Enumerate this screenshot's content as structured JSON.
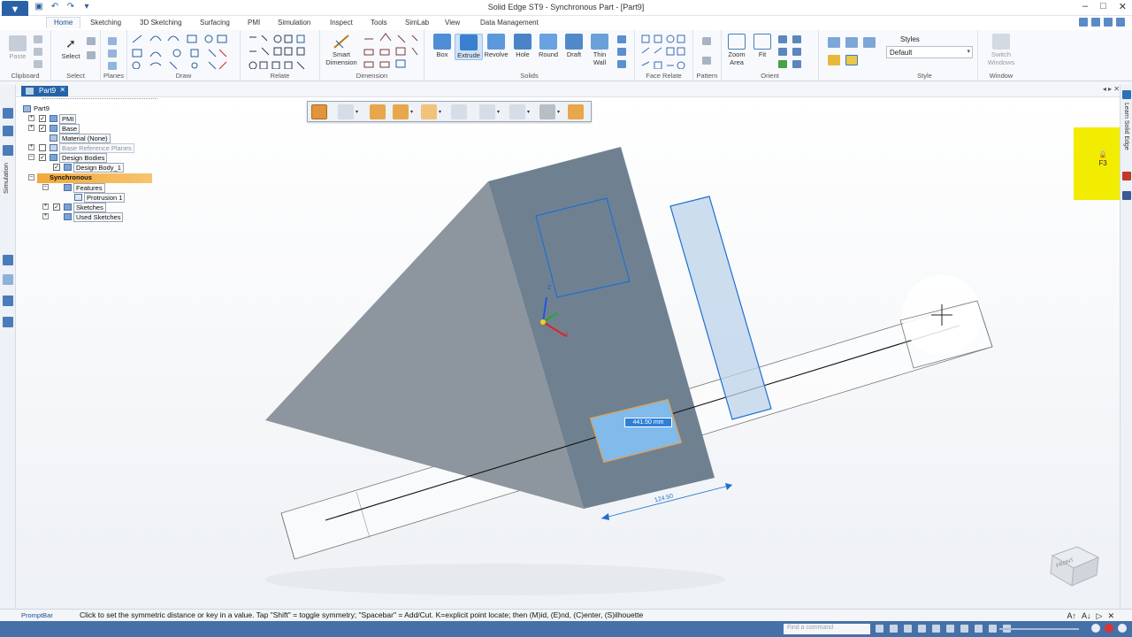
{
  "window": {
    "title": "Solid Edge ST9 - Synchronous Part - [Part9]"
  },
  "tabs": [
    "Home",
    "Sketching",
    "3D Sketching",
    "Surfacing",
    "PMI",
    "Simulation",
    "Inspect",
    "Tools",
    "SimLab",
    "View",
    "Data Management"
  ],
  "ribbon": {
    "groups": [
      "Clipboard",
      "Select",
      "Planes",
      "Draw",
      "Relate",
      "Dimension",
      "Solids",
      "Face Relate",
      "Pattern",
      "Orient",
      "Style",
      "Window"
    ],
    "buttons": {
      "paste": "Paste",
      "select": "Select",
      "smart_dimension_1": "Smart",
      "smart_dimension_2": "Dimension",
      "box": "Box",
      "extrude": "Extrude",
      "revolve": "Revolve",
      "hole": "Hole",
      "round": "Round",
      "draft": "Draft",
      "thin_wall_1": "Thin",
      "thin_wall_2": "Wall",
      "zoom_area_1": "Zoom",
      "zoom_area_2": "Area",
      "fit": "Fit",
      "switch_windows_1": "Switch",
      "switch_windows_2": "Windows"
    },
    "styles": {
      "title": "Styles",
      "value": "Default"
    }
  },
  "left_strip": {
    "vertical_label": "Simulation"
  },
  "document": {
    "tab_label": "Part9"
  },
  "tree": {
    "nodes": [
      {
        "label": "Part9"
      },
      {
        "label": "PMI"
      },
      {
        "label": "Base"
      },
      {
        "label": "Material (None)"
      },
      {
        "label": "Base Reference Planes"
      },
      {
        "label": "Design Bodies"
      },
      {
        "label": "Design Body_1"
      },
      {
        "label": "Synchronous"
      },
      {
        "label": "Features"
      },
      {
        "label": "Protrusion 1"
      },
      {
        "label": "Sketches"
      },
      {
        "label": "Used Sketches"
      }
    ]
  },
  "viewport": {
    "dimension_edit_value": "441.50 mm",
    "dimension_label": "124.50",
    "triad": {
      "z": "Z",
      "x": "X"
    },
    "view_cube_label": "FRONT"
  },
  "right_strip": {
    "vertical_label": "Learn Solid Edge",
    "lock_key": "F3"
  },
  "promptbar": {
    "label": "PromptBar",
    "text": "Click to set the symmetric distance or key in a value. Tap \"Shift\" = toggle symmetry; \"Spacebar\" = Add/Cut.  K=explicit point locate; then (M)id, (E)nd, (C)enter, (S)ilhouette"
  },
  "statusbar": {
    "find_placeholder": "Find a command"
  },
  "colors": {
    "accent": "#2563a8",
    "selection_blue": "#1f6fd0",
    "highlight_orange": "#f2a93b",
    "lock_yellow": "#f2ec00"
  }
}
